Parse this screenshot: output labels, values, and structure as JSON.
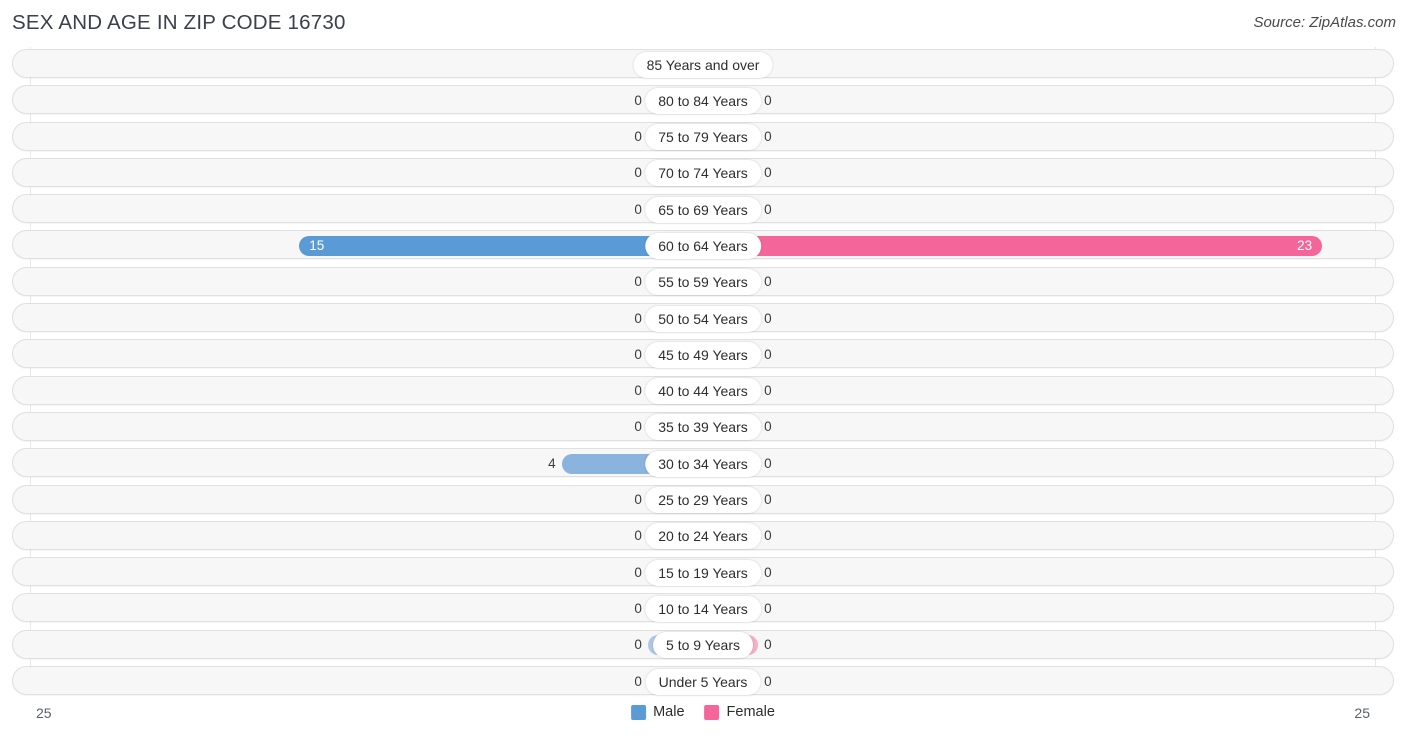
{
  "header": {
    "title": "SEX AND AGE IN ZIP CODE 16730",
    "source": "Source: ZipAtlas.com"
  },
  "legend": {
    "male_label": "Male",
    "female_label": "Female",
    "male_color": "#5B9BD5",
    "female_color": "#F4669A"
  },
  "axis": {
    "min_label": "25",
    "max_label": "25"
  },
  "colors": {
    "male_active": "#5B9BD5",
    "male_mid": "#8AB4DE",
    "male_zero": "#AEC7E8",
    "female_active": "#F4669A",
    "female_zero": "#F6AFC6",
    "track_bg": "#f7f7f7",
    "track_border": "#e0e0e0"
  },
  "chart_data": {
    "type": "bar",
    "title": "SEX AND AGE IN ZIP CODE 16730",
    "subtitle": "Source: ZipAtlas.com",
    "orientation": "horizontal",
    "style": "population-pyramid",
    "xlabel": "",
    "ylabel": "",
    "xlim": [
      25,
      25
    ],
    "axis_min_label": "25",
    "axis_max_label": "25",
    "grid": true,
    "legend_position": "bottom-center",
    "categories": [
      "85 Years and over",
      "80 to 84 Years",
      "75 to 79 Years",
      "70 to 74 Years",
      "65 to 69 Years",
      "60 to 64 Years",
      "55 to 59 Years",
      "50 to 54 Years",
      "45 to 49 Years",
      "40 to 44 Years",
      "35 to 39 Years",
      "30 to 34 Years",
      "25 to 29 Years",
      "20 to 24 Years",
      "15 to 19 Years",
      "10 to 14 Years",
      "5 to 9 Years",
      "Under 5 Years"
    ],
    "series": [
      {
        "name": "Male",
        "color": "#5B9BD5",
        "values": [
          0,
          0,
          0,
          0,
          0,
          15,
          0,
          0,
          0,
          0,
          0,
          4,
          0,
          0,
          0,
          0,
          0,
          0
        ]
      },
      {
        "name": "Female",
        "color": "#F4669A",
        "values": [
          0,
          0,
          0,
          0,
          0,
          23,
          0,
          0,
          0,
          0,
          0,
          0,
          0,
          0,
          0,
          0,
          0,
          0
        ]
      }
    ]
  },
  "rows": [
    {
      "label": "85 Years and over",
      "male": "0",
      "female": "0",
      "male_pct": 8.2,
      "female_pct": 8.2,
      "male_tone": "zero",
      "female_tone": "zero",
      "male_inside": false,
      "female_inside": false
    },
    {
      "label": "80 to 84 Years",
      "male": "0",
      "female": "0",
      "male_pct": 8.2,
      "female_pct": 8.2,
      "male_tone": "zero",
      "female_tone": "zero",
      "male_inside": false,
      "female_inside": false
    },
    {
      "label": "75 to 79 Years",
      "male": "0",
      "female": "0",
      "male_pct": 8.2,
      "female_pct": 8.2,
      "male_tone": "zero",
      "female_tone": "zero",
      "male_inside": false,
      "female_inside": false
    },
    {
      "label": "70 to 74 Years",
      "male": "0",
      "female": "0",
      "male_pct": 8.2,
      "female_pct": 8.2,
      "male_tone": "zero",
      "female_tone": "zero",
      "male_inside": false,
      "female_inside": false
    },
    {
      "label": "65 to 69 Years",
      "male": "0",
      "female": "0",
      "male_pct": 8.2,
      "female_pct": 8.2,
      "male_tone": "zero",
      "female_tone": "zero",
      "male_inside": false,
      "female_inside": false
    },
    {
      "label": "60 to 64 Years",
      "male": "15",
      "female": "23",
      "male_pct": 60.0,
      "female_pct": 92.0,
      "male_tone": "active",
      "female_tone": "active",
      "male_inside": true,
      "female_inside": true
    },
    {
      "label": "55 to 59 Years",
      "male": "0",
      "female": "0",
      "male_pct": 8.2,
      "female_pct": 8.2,
      "male_tone": "zero",
      "female_tone": "zero",
      "male_inside": false,
      "female_inside": false
    },
    {
      "label": "50 to 54 Years",
      "male": "0",
      "female": "0",
      "male_pct": 8.2,
      "female_pct": 8.2,
      "male_tone": "zero",
      "female_tone": "zero",
      "male_inside": false,
      "female_inside": false
    },
    {
      "label": "45 to 49 Years",
      "male": "0",
      "female": "0",
      "male_pct": 8.2,
      "female_pct": 8.2,
      "male_tone": "zero",
      "female_tone": "zero",
      "male_inside": false,
      "female_inside": false
    },
    {
      "label": "40 to 44 Years",
      "male": "0",
      "female": "0",
      "male_pct": 8.2,
      "female_pct": 8.2,
      "male_tone": "zero",
      "female_tone": "zero",
      "male_inside": false,
      "female_inside": false
    },
    {
      "label": "35 to 39 Years",
      "male": "0",
      "female": "0",
      "male_pct": 8.2,
      "female_pct": 8.2,
      "male_tone": "zero",
      "female_tone": "zero",
      "male_inside": false,
      "female_inside": false
    },
    {
      "label": "30 to 34 Years",
      "male": "4",
      "female": "0",
      "male_pct": 21.0,
      "female_pct": 8.2,
      "male_tone": "mid",
      "female_tone": "zero",
      "male_inside": false,
      "female_inside": false
    },
    {
      "label": "25 to 29 Years",
      "male": "0",
      "female": "0",
      "male_pct": 8.2,
      "female_pct": 8.2,
      "male_tone": "zero",
      "female_tone": "zero",
      "male_inside": false,
      "female_inside": false
    },
    {
      "label": "20 to 24 Years",
      "male": "0",
      "female": "0",
      "male_pct": 8.2,
      "female_pct": 8.2,
      "male_tone": "zero",
      "female_tone": "zero",
      "male_inside": false,
      "female_inside": false
    },
    {
      "label": "15 to 19 Years",
      "male": "0",
      "female": "0",
      "male_pct": 8.2,
      "female_pct": 8.2,
      "male_tone": "zero",
      "female_tone": "zero",
      "male_inside": false,
      "female_inside": false
    },
    {
      "label": "10 to 14 Years",
      "male": "0",
      "female": "0",
      "male_pct": 8.2,
      "female_pct": 8.2,
      "male_tone": "zero",
      "female_tone": "zero",
      "male_inside": false,
      "female_inside": false
    },
    {
      "label": "5 to 9 Years",
      "male": "0",
      "female": "0",
      "male_pct": 8.2,
      "female_pct": 8.2,
      "male_tone": "zero",
      "female_tone": "zero",
      "male_inside": false,
      "female_inside": false
    },
    {
      "label": "Under 5 Years",
      "male": "0",
      "female": "0",
      "male_pct": 8.2,
      "female_pct": 8.2,
      "male_tone": "zero",
      "female_tone": "zero",
      "male_inside": false,
      "female_inside": false
    }
  ]
}
